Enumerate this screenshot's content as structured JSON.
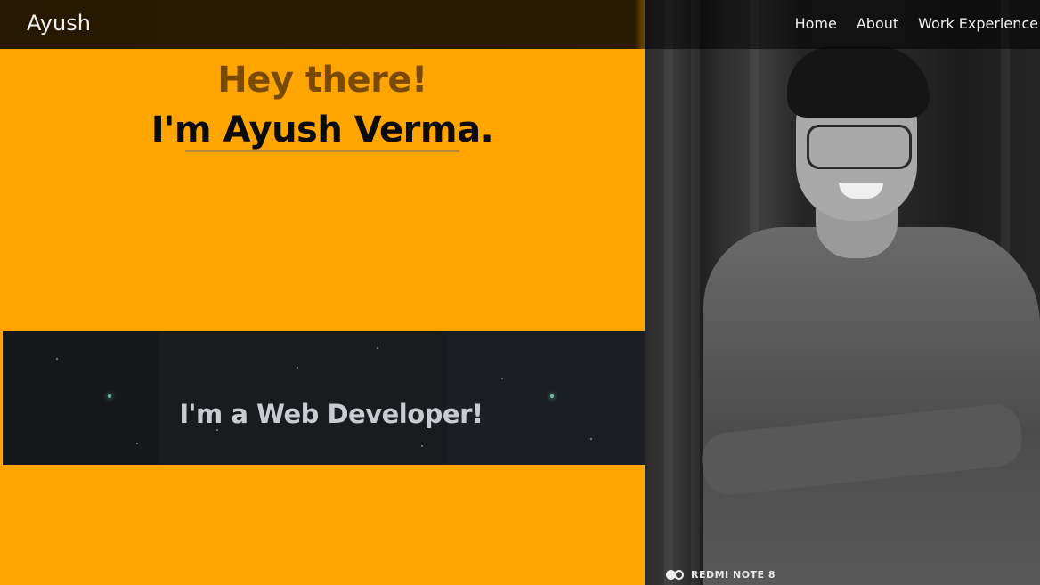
{
  "nav": {
    "brand": "Ayush",
    "links": [
      "Home",
      "About",
      "Work Experience"
    ]
  },
  "hero": {
    "greeting": "Hey there!",
    "intro": "I'm Ayush Verma."
  },
  "banner": {
    "text": "I'm a Web Developer!"
  },
  "photo": {
    "watermark": "REDMI NOTE 8"
  },
  "colors": {
    "accent": "#ffa500",
    "nav_bg": "#1a1002",
    "greeting": "#7a4a05"
  }
}
